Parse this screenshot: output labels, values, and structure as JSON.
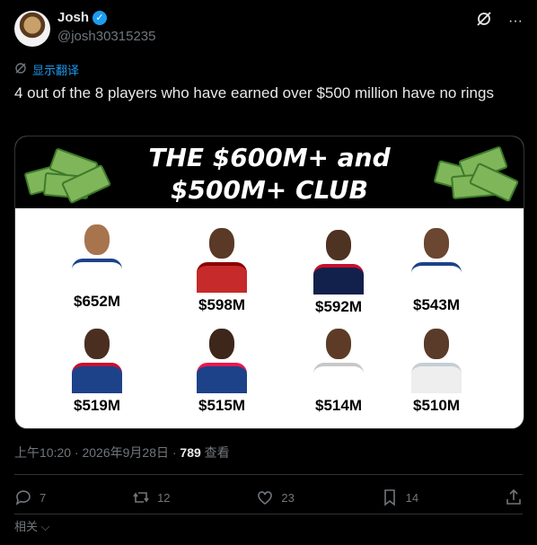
{
  "author": {
    "name": "Josh",
    "handle": "@josh30315235"
  },
  "translate_label": "显示翻译",
  "tweet_text": "4 out of the 8 players who have earned over $500 million have no rings",
  "media": {
    "banner_line1": "THE $600M+ and",
    "banner_line2": "$500M+ CLUB",
    "players": [
      {
        "amount": "$652M",
        "jersey": "#ffffff",
        "accent": "#1d428a"
      },
      {
        "amount": "$598M",
        "jersey": "#c62a2a",
        "accent": "#8b0000"
      },
      {
        "amount": "$592M",
        "jersey": "#12214b",
        "accent": "#c8102e"
      },
      {
        "amount": "$543M",
        "jersey": "#ffffff",
        "accent": "#1d428a"
      },
      {
        "amount": "$519M",
        "jersey": "#1d428a",
        "accent": "#c8102e"
      },
      {
        "amount": "$515M",
        "jersey": "#1d428a",
        "accent": "#ed174c"
      },
      {
        "amount": "$514M",
        "jersey": "#ffffff",
        "accent": "#c8c8c8"
      },
      {
        "amount": "$510M",
        "jersey": "#eeeeee",
        "accent": "#c4ced4"
      }
    ]
  },
  "meta": {
    "time": "上午10:20 · 2026年9月28日 · ",
    "views": "789",
    "views_label": " 查看"
  },
  "actions": {
    "replies": "7",
    "retweets": "12",
    "likes": "23",
    "bookmarks": "14"
  },
  "related_label": "相关"
}
